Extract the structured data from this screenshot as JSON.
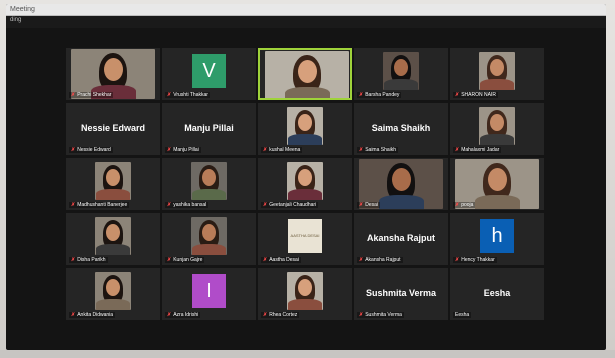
{
  "window": {
    "title": "Meeting",
    "subtitle": "ding"
  },
  "colors": {
    "screen_bg": "#141414",
    "tile_bg": "#252525",
    "speaker_border": "#9fd33a",
    "mic_muted": "#ff4a4a",
    "avatar_green": "#2e9c6a",
    "avatar_purple": "#b04cc9",
    "avatar_blue": "#0a5fb4"
  },
  "participants": [
    {
      "label": "Prachi Shekhar",
      "big_name": "",
      "avatar": "photo"
    },
    {
      "label": "Vrushti Thakkar",
      "big_name": "",
      "avatar": "letter",
      "letter": "V"
    },
    {
      "label": "",
      "big_name": "",
      "avatar": "photo",
      "speaking": true
    },
    {
      "label": "Barsha Pandey",
      "big_name": "",
      "avatar": "photo"
    },
    {
      "label": "SHARON NAIR",
      "big_name": "",
      "avatar": "photo"
    },
    {
      "label": "Nessie Edward",
      "big_name": "Nessie Edward",
      "avatar": "name"
    },
    {
      "label": "Manju Pillai",
      "big_name": "Manju Pillai",
      "avatar": "name"
    },
    {
      "label": "kushal Meena",
      "big_name": "",
      "avatar": "photo"
    },
    {
      "label": "Saima Shaikh",
      "big_name": "Saima Shaikh",
      "avatar": "name"
    },
    {
      "label": "Mahalaxmi Jadar",
      "big_name": "",
      "avatar": "photo"
    },
    {
      "label": "Madhushanti Banerjee",
      "big_name": "",
      "avatar": "photo"
    },
    {
      "label": "yashika bansal",
      "big_name": "",
      "avatar": "photo"
    },
    {
      "label": "Geetanjali Chaudhari",
      "big_name": "",
      "avatar": "photo"
    },
    {
      "label": "Desai",
      "big_name": "",
      "avatar": "photo"
    },
    {
      "label": "pooja",
      "big_name": "",
      "avatar": "photo"
    },
    {
      "label": "Disha Parikh",
      "big_name": "",
      "avatar": "photo"
    },
    {
      "label": "Kunjan Gajre",
      "big_name": "",
      "avatar": "photo"
    },
    {
      "label": "Aastha Desai",
      "big_name": "",
      "avatar": "logo",
      "logo_text": "AASTHA DESAI"
    },
    {
      "label": "Akansha Rajput",
      "big_name": "Akansha Rajput",
      "avatar": "name"
    },
    {
      "label": "Hency Thakkar",
      "big_name": "",
      "avatar": "letter",
      "letter": "h"
    },
    {
      "label": "Ankita Didwania",
      "big_name": "",
      "avatar": "photo"
    },
    {
      "label": "Azra Idrishi",
      "big_name": "",
      "avatar": "letter",
      "letter": "I"
    },
    {
      "label": "Rhea Cortez",
      "big_name": "",
      "avatar": "photo"
    },
    {
      "label": "Sushmita Verma",
      "big_name": "Sushmita Verma",
      "avatar": "name"
    },
    {
      "label": "Eesha",
      "big_name": "Eesha",
      "avatar": "name"
    }
  ]
}
